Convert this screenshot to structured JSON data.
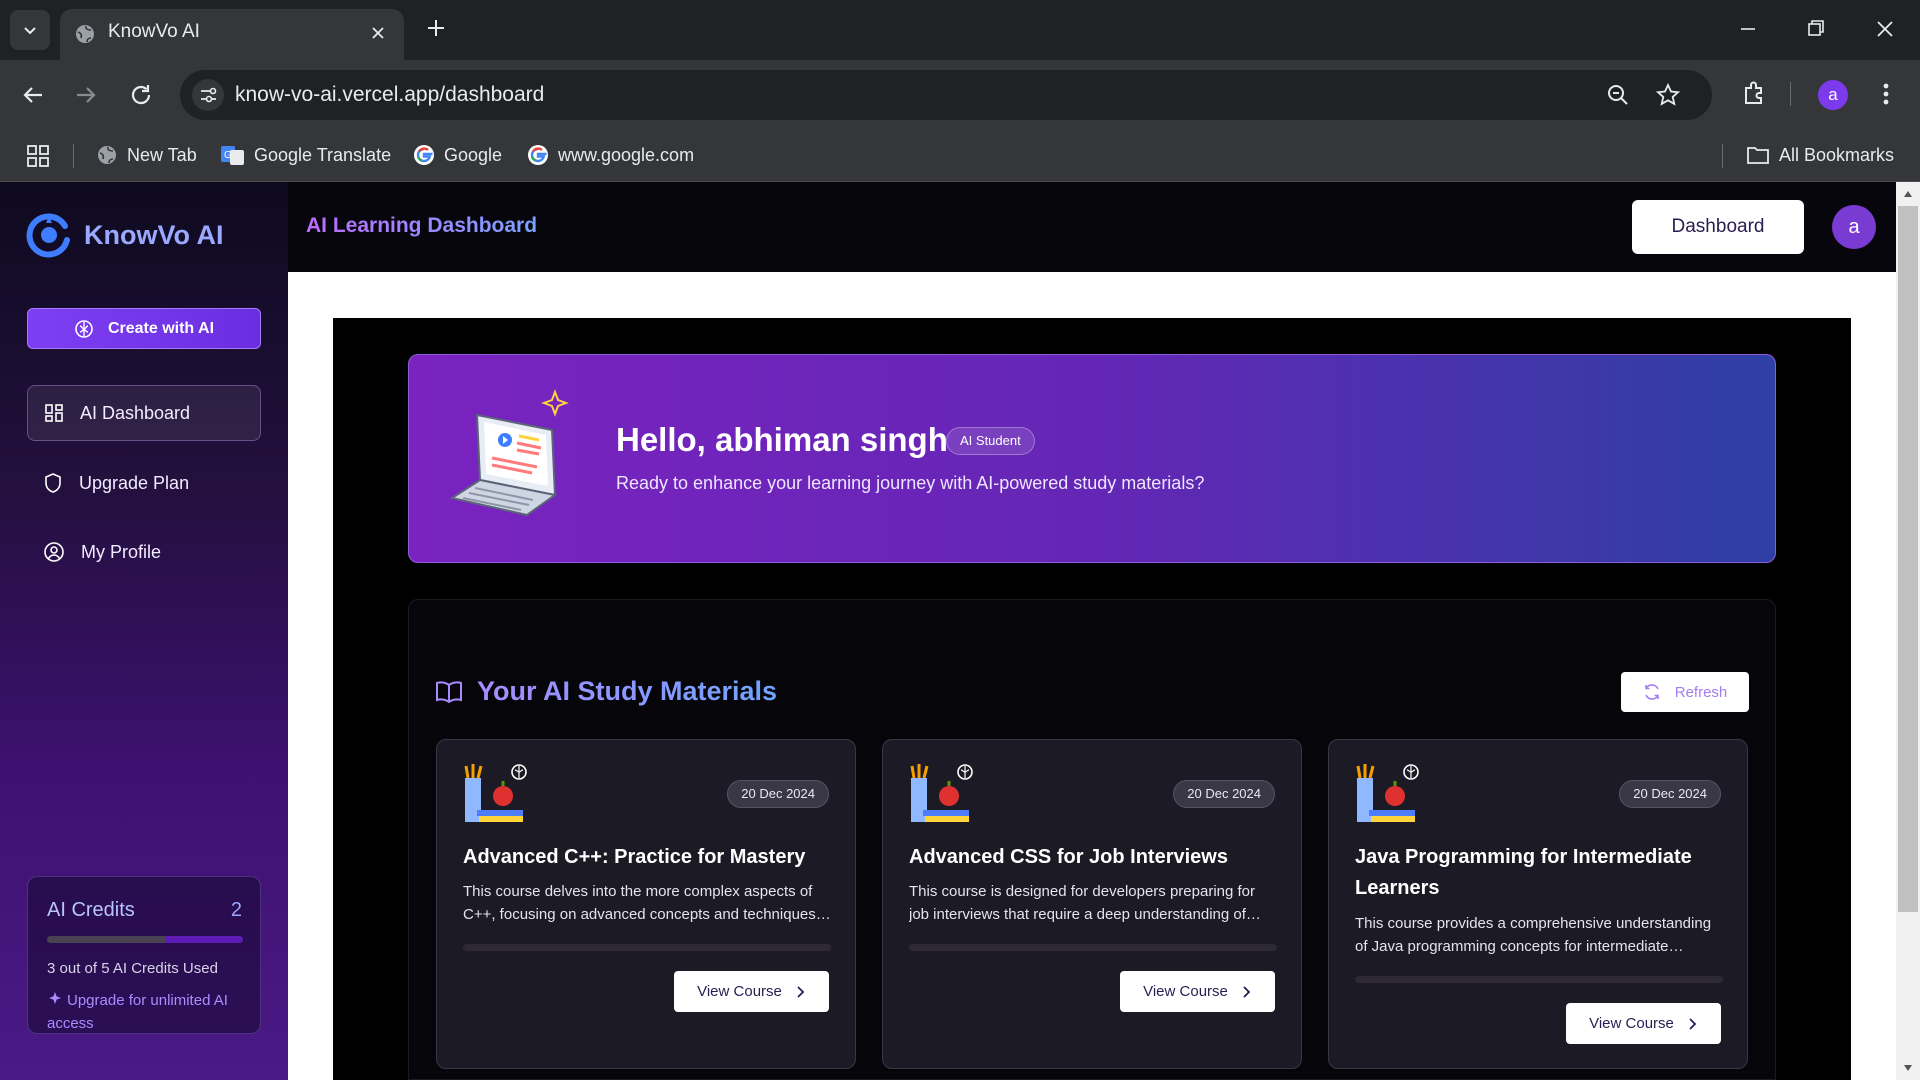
{
  "browser": {
    "tab_title": "KnowVo AI",
    "url": "know-vo-ai.vercel.app/dashboard",
    "profile_letter": "a",
    "bookmarks": [
      {
        "label": "New Tab"
      },
      {
        "label": "Google Translate"
      },
      {
        "label": "Google"
      },
      {
        "label": "www.google.com"
      }
    ],
    "all_bookmarks": "All Bookmarks"
  },
  "sidebar": {
    "brand": "KnowVo AI",
    "create_label": "Create with AI",
    "items": [
      {
        "label": "AI Dashboard",
        "icon": "grid-icon",
        "active": true
      },
      {
        "label": "Upgrade Plan",
        "icon": "shield-icon",
        "active": false
      },
      {
        "label": "My Profile",
        "icon": "user-circle-icon",
        "active": false
      }
    ],
    "credits": {
      "title": "AI Credits",
      "count": "2",
      "used_text": "3 out of 5 AI Credits Used",
      "used_fraction": 0.6,
      "upgrade_text": "Upgrade for unlimited AI access"
    }
  },
  "header": {
    "title": "AI Learning Dashboard",
    "dashboard_button": "Dashboard",
    "avatar_letter": "a"
  },
  "hero": {
    "greeting": "Hello, abhiman singh",
    "badge": "AI Student",
    "subtitle": "Ready to enhance your learning journey with AI-powered study materials?"
  },
  "materials": {
    "title": "Your AI Study Materials",
    "refresh_label": "Refresh",
    "courses": [
      {
        "date": "20 Dec 2024",
        "title": "Advanced C++: Practice for Mastery",
        "description": "This course delves into the more complex aspects of C++, focusing on advanced concepts and techniques for mastery.",
        "view_label": "View Course"
      },
      {
        "date": "20 Dec 2024",
        "title": "Advanced CSS for Job Interviews",
        "description": "This course is designed for developers preparing for job interviews that require a deep understanding of advanced CSS.",
        "view_label": "View Course"
      },
      {
        "date": "20 Dec 2024",
        "title": "Java Programming for Intermediate Learners",
        "description": "This course provides a comprehensive understanding of Java programming concepts for intermediate learners.",
        "view_label": "View Course"
      }
    ]
  },
  "colors": {
    "accent": "#7e3ff2",
    "sidebar_bottom": "#4a1a86",
    "hero_start": "#7a23c0",
    "hero_end": "#2e3fa5"
  }
}
